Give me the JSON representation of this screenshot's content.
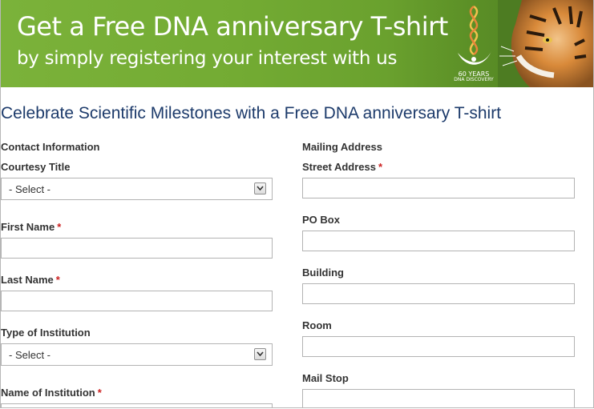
{
  "banner": {
    "headline": "Get a Free DNA anniversary T-shirt",
    "subline": "by simply registering your interest with us",
    "logo_top": "60 YEARS",
    "logo_bottom": "DNA DISCOVERY"
  },
  "page_title": "Celebrate Scientific Milestones with a Free DNA anniversary T-shirt",
  "contact": {
    "section_label": "Contact Information",
    "courtesy_title": {
      "label": "Courtesy Title",
      "value": "- Select -"
    },
    "first_name": {
      "label": "First Name",
      "required": "*",
      "value": ""
    },
    "last_name": {
      "label": "Last Name",
      "required": "*",
      "value": ""
    },
    "institution_type": {
      "label": "Type of Institution",
      "value": "- Select -"
    },
    "institution_name": {
      "label": "Name of Institution",
      "required": "*",
      "value": ""
    }
  },
  "mailing": {
    "section_label": "Mailing Address",
    "street": {
      "label": "Street Address",
      "required": "*",
      "value": ""
    },
    "po_box": {
      "label": "PO Box",
      "value": ""
    },
    "building": {
      "label": "Building",
      "value": ""
    },
    "room": {
      "label": "Room",
      "value": ""
    },
    "mail_stop": {
      "label": "Mail Stop",
      "value": ""
    }
  },
  "colors": {
    "banner_green": "#73ab33",
    "title_blue": "#1d3b6b",
    "required_red": "#cc2222"
  },
  "icons": {
    "dropdown": "chevron-down-icon",
    "logo": "dna-helix-icon",
    "photo": "tiger-image"
  }
}
